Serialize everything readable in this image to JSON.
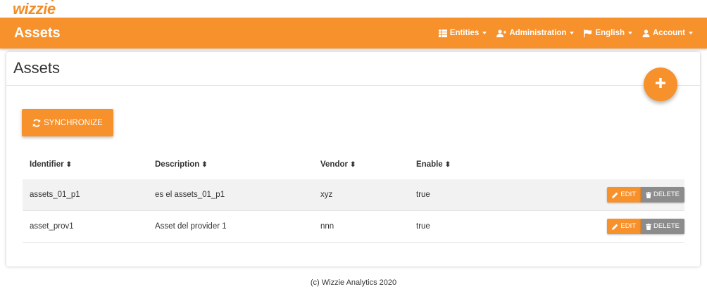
{
  "logo_text": "wizzie",
  "header": {
    "title": "Assets",
    "nav": [
      {
        "label": "Entities",
        "icon": "list-icon"
      },
      {
        "label": "Administration",
        "icon": "user-plus-icon"
      },
      {
        "label": "English",
        "icon": "flag-icon"
      },
      {
        "label": "Account",
        "icon": "user-icon"
      }
    ]
  },
  "card": {
    "title": "Assets",
    "add_button_icon": "plus-icon",
    "sync_label": "SYNCHRONIZE",
    "sync_icon": "refresh-icon"
  },
  "table": {
    "columns": [
      "Identifier",
      "Description",
      "Vendor",
      "Enable"
    ],
    "rows": [
      {
        "identifier": "assets_01_p1",
        "description": "es el assets_01_p1",
        "vendor": "xyz",
        "enable": "true"
      },
      {
        "identifier": "asset_prov1",
        "description": "Asset del provider 1",
        "vendor": "nnn",
        "enable": "true"
      }
    ],
    "edit_label": "EDIT",
    "delete_label": "DELETE"
  },
  "footer": "(c) Wizzie Analytics 2020",
  "colors": {
    "accent": "#f7912b",
    "delete": "#8c8c8c"
  }
}
